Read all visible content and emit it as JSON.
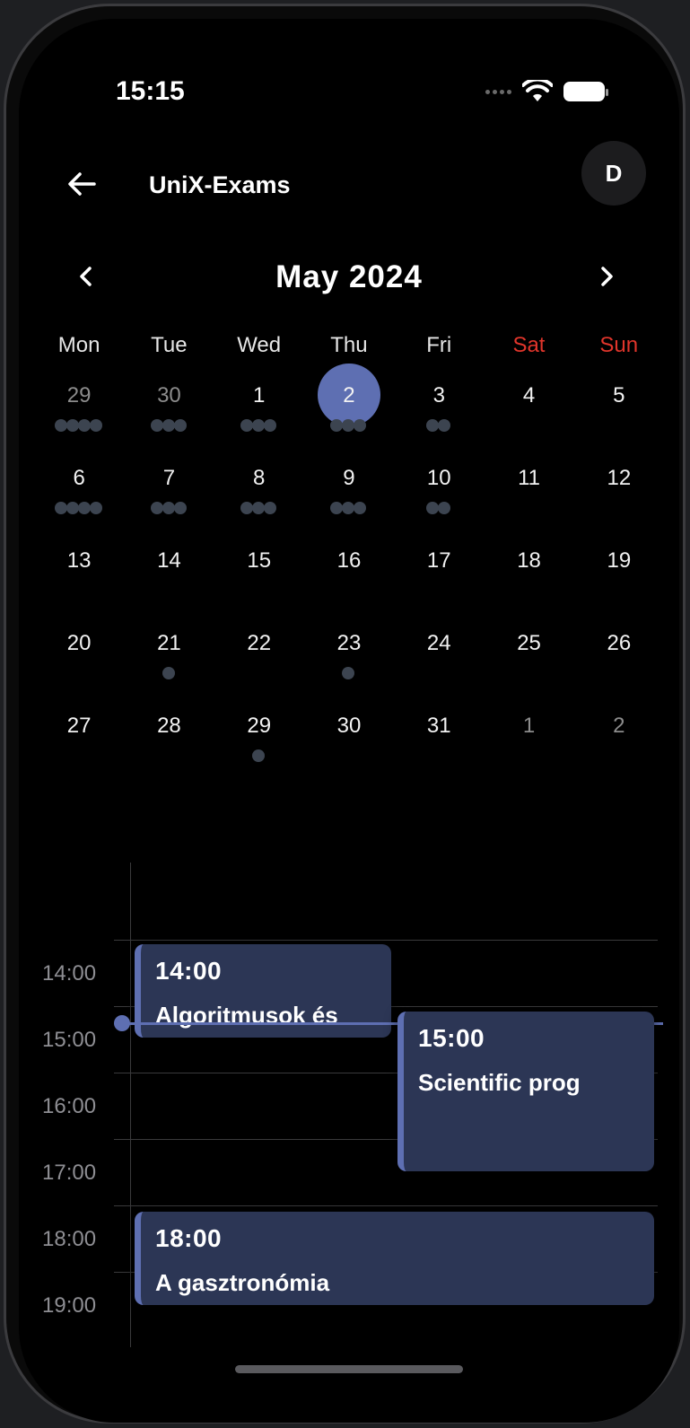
{
  "status_bar": {
    "time": "15:15"
  },
  "header": {
    "title": "UniX-Exams",
    "avatar_initial": "D",
    "back_icon": "arrow-left-icon"
  },
  "calendar": {
    "month_label": "May 2024",
    "weekdays": [
      "Mon",
      "Tue",
      "Wed",
      "Thu",
      "Fri",
      "Sat",
      "Sun"
    ],
    "weekend_color": "#e0352b",
    "selected_color": "#5e6fb2",
    "weeks": [
      [
        {
          "d": "29",
          "other": true,
          "dots": 4
        },
        {
          "d": "30",
          "other": true,
          "dots": 3
        },
        {
          "d": "1",
          "dots": 3
        },
        {
          "d": "2",
          "dots": 3,
          "selected": true
        },
        {
          "d": "3",
          "dots": 2
        },
        {
          "d": "4",
          "dots": 0
        },
        {
          "d": "5",
          "dots": 0
        }
      ],
      [
        {
          "d": "6",
          "dots": 4
        },
        {
          "d": "7",
          "dots": 3
        },
        {
          "d": "8",
          "dots": 3
        },
        {
          "d": "9",
          "dots": 3
        },
        {
          "d": "10",
          "dots": 2
        },
        {
          "d": "11",
          "dots": 0
        },
        {
          "d": "12",
          "dots": 0
        }
      ],
      [
        {
          "d": "13",
          "dots": 0
        },
        {
          "d": "14",
          "dots": 0
        },
        {
          "d": "15",
          "dots": 0
        },
        {
          "d": "16",
          "dots": 0
        },
        {
          "d": "17",
          "dots": 0
        },
        {
          "d": "18",
          "dots": 0
        },
        {
          "d": "19",
          "dots": 0
        }
      ],
      [
        {
          "d": "20",
          "dots": 0
        },
        {
          "d": "21",
          "dots": 1
        },
        {
          "d": "22",
          "dots": 0
        },
        {
          "d": "23",
          "dots": 1
        },
        {
          "d": "24",
          "dots": 0
        },
        {
          "d": "25",
          "dots": 0
        },
        {
          "d": "26",
          "dots": 0
        }
      ],
      [
        {
          "d": "27",
          "dots": 0
        },
        {
          "d": "28",
          "dots": 0
        },
        {
          "d": "29",
          "dots": 1
        },
        {
          "d": "30",
          "dots": 0
        },
        {
          "d": "31",
          "dots": 0
        },
        {
          "d": "1",
          "other": true,
          "dots": 0
        },
        {
          "d": "2",
          "other": true,
          "dots": 0
        }
      ]
    ]
  },
  "timeline": {
    "hours": [
      "14:00",
      "15:00",
      "16:00",
      "17:00",
      "18:00",
      "19:00"
    ],
    "events": [
      {
        "time": "14:00",
        "title": "Algoritmusok és"
      },
      {
        "time": "15:00",
        "title": "Scientific prog"
      },
      {
        "time": "18:00",
        "title": "A gasztronómia"
      }
    ],
    "accent_color": "#5e6fb2",
    "event_color": "#2c3655"
  }
}
